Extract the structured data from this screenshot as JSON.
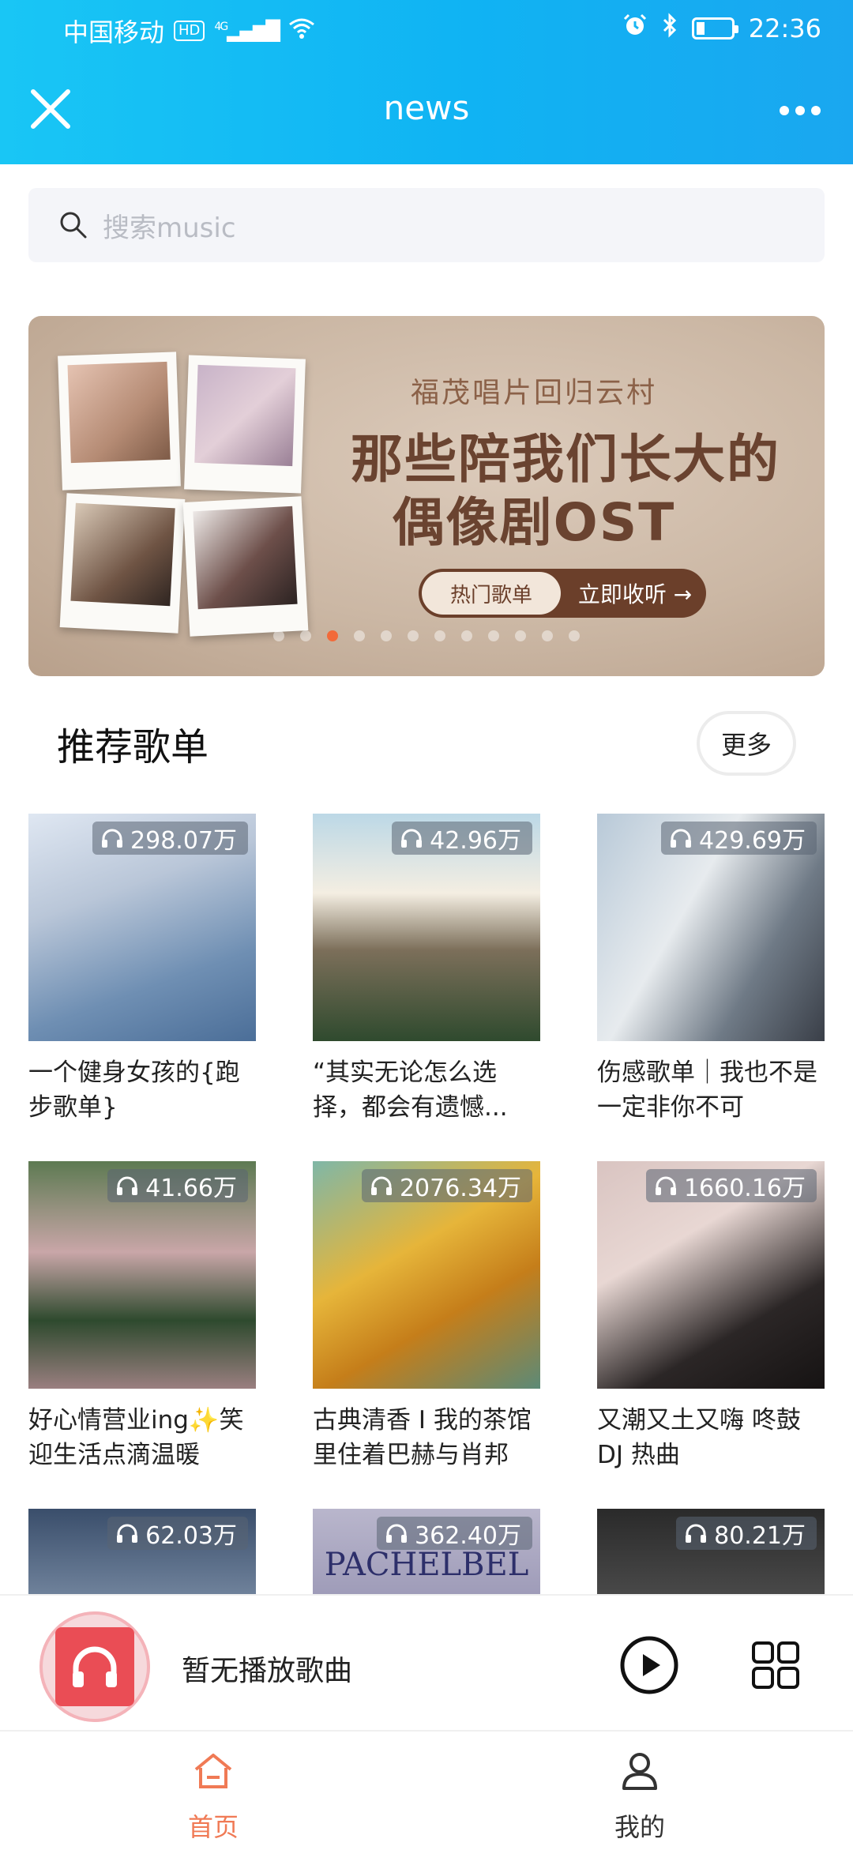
{
  "status_bar": {
    "carrier": "中国移动",
    "hd": "HD",
    "network": "4G",
    "time": "22:36"
  },
  "header": {
    "title": "news"
  },
  "search": {
    "placeholder": "搜索music"
  },
  "banner": {
    "subtitle": "福茂唱片回归云村",
    "title_line1": "那些陪我们长大的",
    "title_line2": "偶像剧OST",
    "tag": "热门歌单",
    "cta": "立即收听 →",
    "dot_count": 12,
    "active_dot": 2
  },
  "section": {
    "title": "推荐歌单",
    "more_label": "更多"
  },
  "playlists": [
    {
      "count": "298.07万",
      "title": "一个健身女孩的{跑步歌单}"
    },
    {
      "count": "42.96万",
      "title": "“其实无论怎么选择，都会有遗憾..."
    },
    {
      "count": "429.69万",
      "title": "伤感歌单｜我也不是一定非你不可"
    },
    {
      "count": "41.66万",
      "title": "好心情营业ing✨笑迎生活点滴温暖"
    },
    {
      "count": "2076.34万",
      "title": "古典清香 I 我的茶馆里住着巴赫与肖邦"
    },
    {
      "count": "1660.16万",
      "title": "又潮又土又嗨 咚鼓DJ 热曲"
    },
    {
      "count": "62.03万",
      "title": ""
    },
    {
      "count": "362.40万",
      "title": "",
      "cover_text": "PACHELBEL"
    },
    {
      "count": "80.21万",
      "title": ""
    }
  ],
  "player": {
    "now_playing": "暂无播放歌曲"
  },
  "nav": {
    "home": "首页",
    "me": "我的",
    "active_color": "#f07a55"
  },
  "colors": {
    "header_gradient_start": "#19c6f5",
    "header_gradient_end": "#1aa7f0",
    "accent": "#f07a55",
    "player_icon": "#ea4d55"
  }
}
